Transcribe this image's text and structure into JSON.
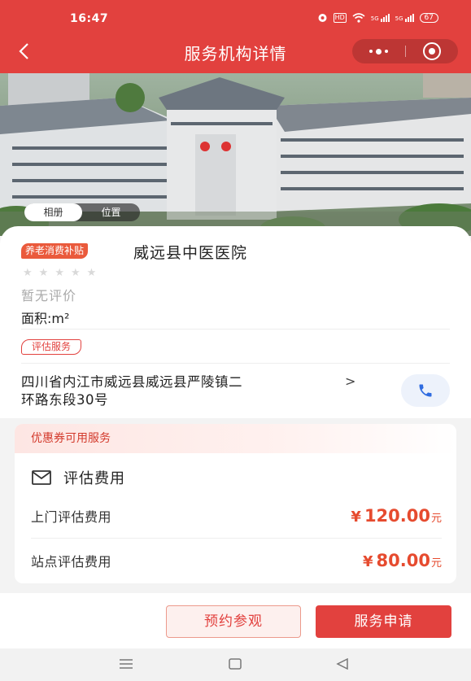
{
  "status_bar": {
    "time": "16:47",
    "battery": "67",
    "signal_labels": [
      "HD",
      "5G",
      "5G"
    ]
  },
  "header": {
    "back_icon": "chevron-left-icon",
    "title": "服务机构详情",
    "more_icon": "more-dots-icon",
    "close_icon": "target-close-icon"
  },
  "hero": {
    "tabs": [
      "相册",
      "位置"
    ],
    "active_tab": "相册"
  },
  "institution": {
    "subsidy_badge": "养老消费补贴",
    "name": "威远县中医医院",
    "rating_stars": 0,
    "rating_max": 5,
    "no_review": "暂无评价",
    "area": "面积:m²",
    "service_tag": "评估服务",
    "address_line1": "四川省内江市威远县威远县严陵镇二",
    "address_line2": "环路东段30号",
    "address_arrow": ">",
    "phone_icon": "phone-icon"
  },
  "coupon": {
    "header": "优惠券可用服务",
    "section_title": "评估费用",
    "section_icon": "mail-icon",
    "fees": [
      {
        "label": "上门评估费用",
        "currency": "¥",
        "amount": "120.00",
        "unit": "元"
      },
      {
        "label": "站点评估费用",
        "currency": "¥",
        "amount": "80.00",
        "unit": "元"
      }
    ]
  },
  "actions": {
    "visit": "预约参观",
    "apply": "服务申请"
  },
  "colors": {
    "primary": "#e2413e",
    "price": "#e64b2f",
    "badge": "#ea5a3c"
  },
  "system_nav": {
    "icons": [
      "menu-icon",
      "home-square-icon",
      "back-triangle-icon"
    ]
  }
}
